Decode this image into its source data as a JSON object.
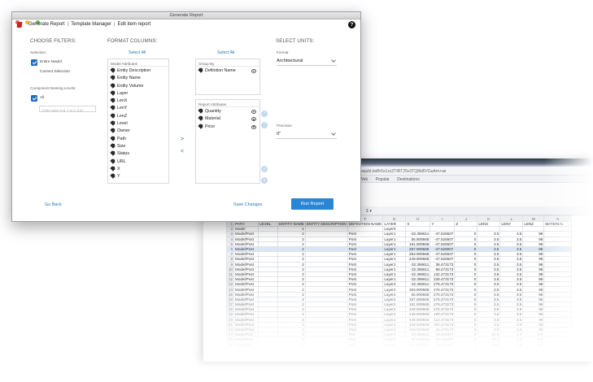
{
  "window": {
    "title": "Generate Report",
    "colors": {
      "close": "#ec5a55",
      "minimize": "#f3bc3a",
      "zoom": "#5cc444"
    }
  },
  "nav": {
    "links": [
      "Generate Report",
      "Template Manager",
      "Edit item report"
    ],
    "help_label": "?"
  },
  "filters": {
    "heading": "CHOOSE FILTERS:",
    "selection_label": "Selection:",
    "entire_model": "Entire Model",
    "current_selection": "Current Selection",
    "nesting_label": "Component Nesting Levels:",
    "all_label": "All",
    "level_placeholder": "Enter value (e.g. 1 to 3, 6-8)"
  },
  "columns": {
    "heading": "FORMAT COLUMNS:",
    "select_all_left": "Select All",
    "select_all_right": "Select All",
    "model_attributes_header": "Model Attributes",
    "model_attributes": [
      "Entity Description",
      "Entity Name",
      "Entity Volume",
      "Layer",
      "LenX",
      "LenY",
      "LenZ",
      "Level",
      "Owner",
      "Path",
      "Size",
      "Status",
      "URL",
      "X",
      "Y"
    ],
    "group_by_header": "Group By",
    "group_by": [
      "Definition Name"
    ],
    "report_attributes_header": "Report Attributes",
    "report_attributes": [
      "Quantity",
      "Material",
      "Price"
    ],
    "move_right": ">",
    "move_left": "<",
    "order_up": "^",
    "order_down": "v"
  },
  "units": {
    "heading": "SELECT UNITS:",
    "format_label": "Format",
    "format_value": "Architectural",
    "precision_label": "Precision",
    "precision_value": "0\""
  },
  "actions": {
    "go_back": "Go Back",
    "save_changes": "Save Changes",
    "run_report": "Run Report",
    "accent": "#2a86d4"
  },
  "spreadsheet": {
    "url": "aqubLbsBr5s1zzZTtRT25v3TQ8ld6VGuAm+ae",
    "bookmarks": [
      "Web",
      "Popular",
      "Destinations"
    ],
    "toolbar_text": "Σ ▾",
    "columns": [
      "",
      "F",
      "G",
      "H",
      "I",
      "J",
      "K",
      "L",
      "M",
      "N"
    ],
    "rows": [
      [
        "1",
        "PATH",
        "LEVEL",
        "ENTITY NAME",
        "ENTITY DESCRIPTION",
        "DEFINITION NAME",
        "LAYER",
        "X",
        "Y",
        "Z",
        "LENX",
        "LENY",
        "LENZ",
        "MATERIAL"
      ],
      [
        "2",
        "Model",
        "",
        "1",
        "",
        "",
        "Layer0",
        "",
        "",
        "",
        "",
        "",
        "",
        ""
      ],
      [
        "3",
        "Model/Post",
        "",
        "2",
        "",
        "Post",
        "Layer1",
        "-32.396611",
        "-47.526507",
        "0",
        "3.5",
        "3.5",
        "96",
        ""
      ],
      [
        "4",
        "Model/Post",
        "",
        "2",
        "",
        "Post",
        "Layer1",
        "65.909568",
        "-47.526507",
        "0",
        "3.5",
        "3.5",
        "96",
        ""
      ],
      [
        "5",
        "Model/Post",
        "",
        "2",
        "",
        "Post",
        "Layer1",
        "161.909568",
        "-47.526507",
        "0",
        "3.5",
        "3.5",
        "96",
        ""
      ],
      [
        "6",
        "Model/Post",
        "",
        "2",
        "",
        "Post",
        "Layer1",
        "257.909568",
        "-47.526507",
        "0",
        "3.5",
        "3.5",
        "96",
        ""
      ],
      [
        "7",
        "Model/Post",
        "",
        "2",
        "",
        "Post",
        "Layer1",
        "353.909568",
        "-47.526507",
        "0",
        "3.5",
        "3.5",
        "96",
        ""
      ],
      [
        "8",
        "Model/Post",
        "",
        "2",
        "",
        "Post",
        "Layer1",
        "449.909568",
        "-47.526507",
        "0",
        "3.5",
        "3.5",
        "96",
        ""
      ],
      [
        "9",
        "Model/Post",
        "",
        "2",
        "",
        "Post",
        "Layer1",
        "-32.396611",
        "36.473173",
        "0",
        "3.5",
        "3.5",
        "96",
        ""
      ],
      [
        "10",
        "Model/Post",
        "",
        "2",
        "",
        "Post",
        "Layer1",
        "-32.396611",
        "98.473173",
        "0",
        "3.5",
        "3.5",
        "96",
        ""
      ],
      [
        "11",
        "Model/Post",
        "",
        "2",
        "",
        "Post",
        "Layer1",
        "-32.396611",
        "132.473173",
        "0",
        "3.5",
        "3.5",
        "96",
        ""
      ],
      [
        "12",
        "Model/Post",
        "",
        "2",
        "",
        "Post",
        "Layer1",
        "-32.396611",
        "228.473173",
        "0",
        "3.5",
        "3.5",
        "96",
        ""
      ],
      [
        "13",
        "Model/Post",
        "",
        "2",
        "",
        "Post",
        "Layer2",
        "-32.396611",
        "276.473173",
        "0",
        "3.5",
        "3.5",
        "96",
        ""
      ],
      [
        "14",
        "Model/Post",
        "",
        "2",
        "",
        "Post",
        "Layer2",
        "353.909568",
        "276.473173",
        "0",
        "3.5",
        "3.5",
        "96",
        ""
      ],
      [
        "15",
        "Model/Post",
        "",
        "2",
        "",
        "Post",
        "Layer2",
        "65.909568",
        "276.473173",
        "0",
        "3.5",
        "3.5",
        "96",
        ""
      ],
      [
        "16",
        "Model/Post",
        "",
        "2",
        "",
        "Post",
        "Layer2",
        "257.909568",
        "276.473173",
        "0",
        "3.5",
        "3.5",
        "96",
        ""
      ],
      [
        "17",
        "Model/Post",
        "",
        "2",
        "",
        "Post",
        "Layer2",
        "161.909568",
        "276.473173",
        "0",
        "3.5",
        "3.5",
        "96",
        ""
      ],
      [
        "18",
        "Model/Post",
        "",
        "2",
        "",
        "Post",
        "Layer2",
        "449.909568",
        "276.473173",
        "0",
        "3.5",
        "3.5",
        "96",
        ""
      ],
      [
        "19",
        "Model/Post",
        "",
        "2",
        "",
        "Post",
        "Layer2",
        "449.909568",
        "180.473173",
        "0",
        "3.5",
        "3.5",
        "96",
        ""
      ],
      [
        "20",
        "Model/Post",
        "",
        "2",
        "",
        "Post",
        "Layer2",
        "449.909568",
        "114.473173",
        "0",
        "3.5",
        "3.5",
        "96",
        ""
      ],
      [
        "21",
        "Model/Post",
        "",
        "2",
        "",
        "Post",
        "Layer2",
        "449.909568",
        "105.473173",
        "0",
        "3.5",
        "3.5",
        "96",
        ""
      ],
      [
        "22",
        "Model/Post",
        "",
        "2",
        "",
        "Post",
        "Layer2",
        "449.909568",
        "42.473173",
        "0",
        "3.5",
        "3.5",
        "96",
        ""
      ],
      [
        "23",
        "Model/Rail",
        "",
        "2",
        "",
        "Rail",
        "Layer3",
        "-25.396611",
        "-44.526507",
        "0",
        "92.5",
        "1.5",
        "3.5",
        ""
      ],
      [
        "24",
        "Model/Rail",
        "",
        "2",
        "",
        "Rail",
        "Layer3",
        "65.909568",
        "-44.526507",
        "0",
        "92.5",
        "1.5",
        "3.5",
        ""
      ],
      [
        "25",
        "Model/Rail",
        "",
        "2",
        "",
        "Rail",
        "Layer3",
        "161.909568",
        "-44.526507",
        "0",
        "92.5",
        "1.5",
        "3.5",
        ""
      ],
      [
        "26",
        "Model/Rail",
        "",
        "2",
        "",
        "Rail",
        "Layer3",
        "257.909568",
        "-44.526507",
        "0",
        "92.5",
        "1.5",
        "3.5",
        ""
      ]
    ]
  }
}
